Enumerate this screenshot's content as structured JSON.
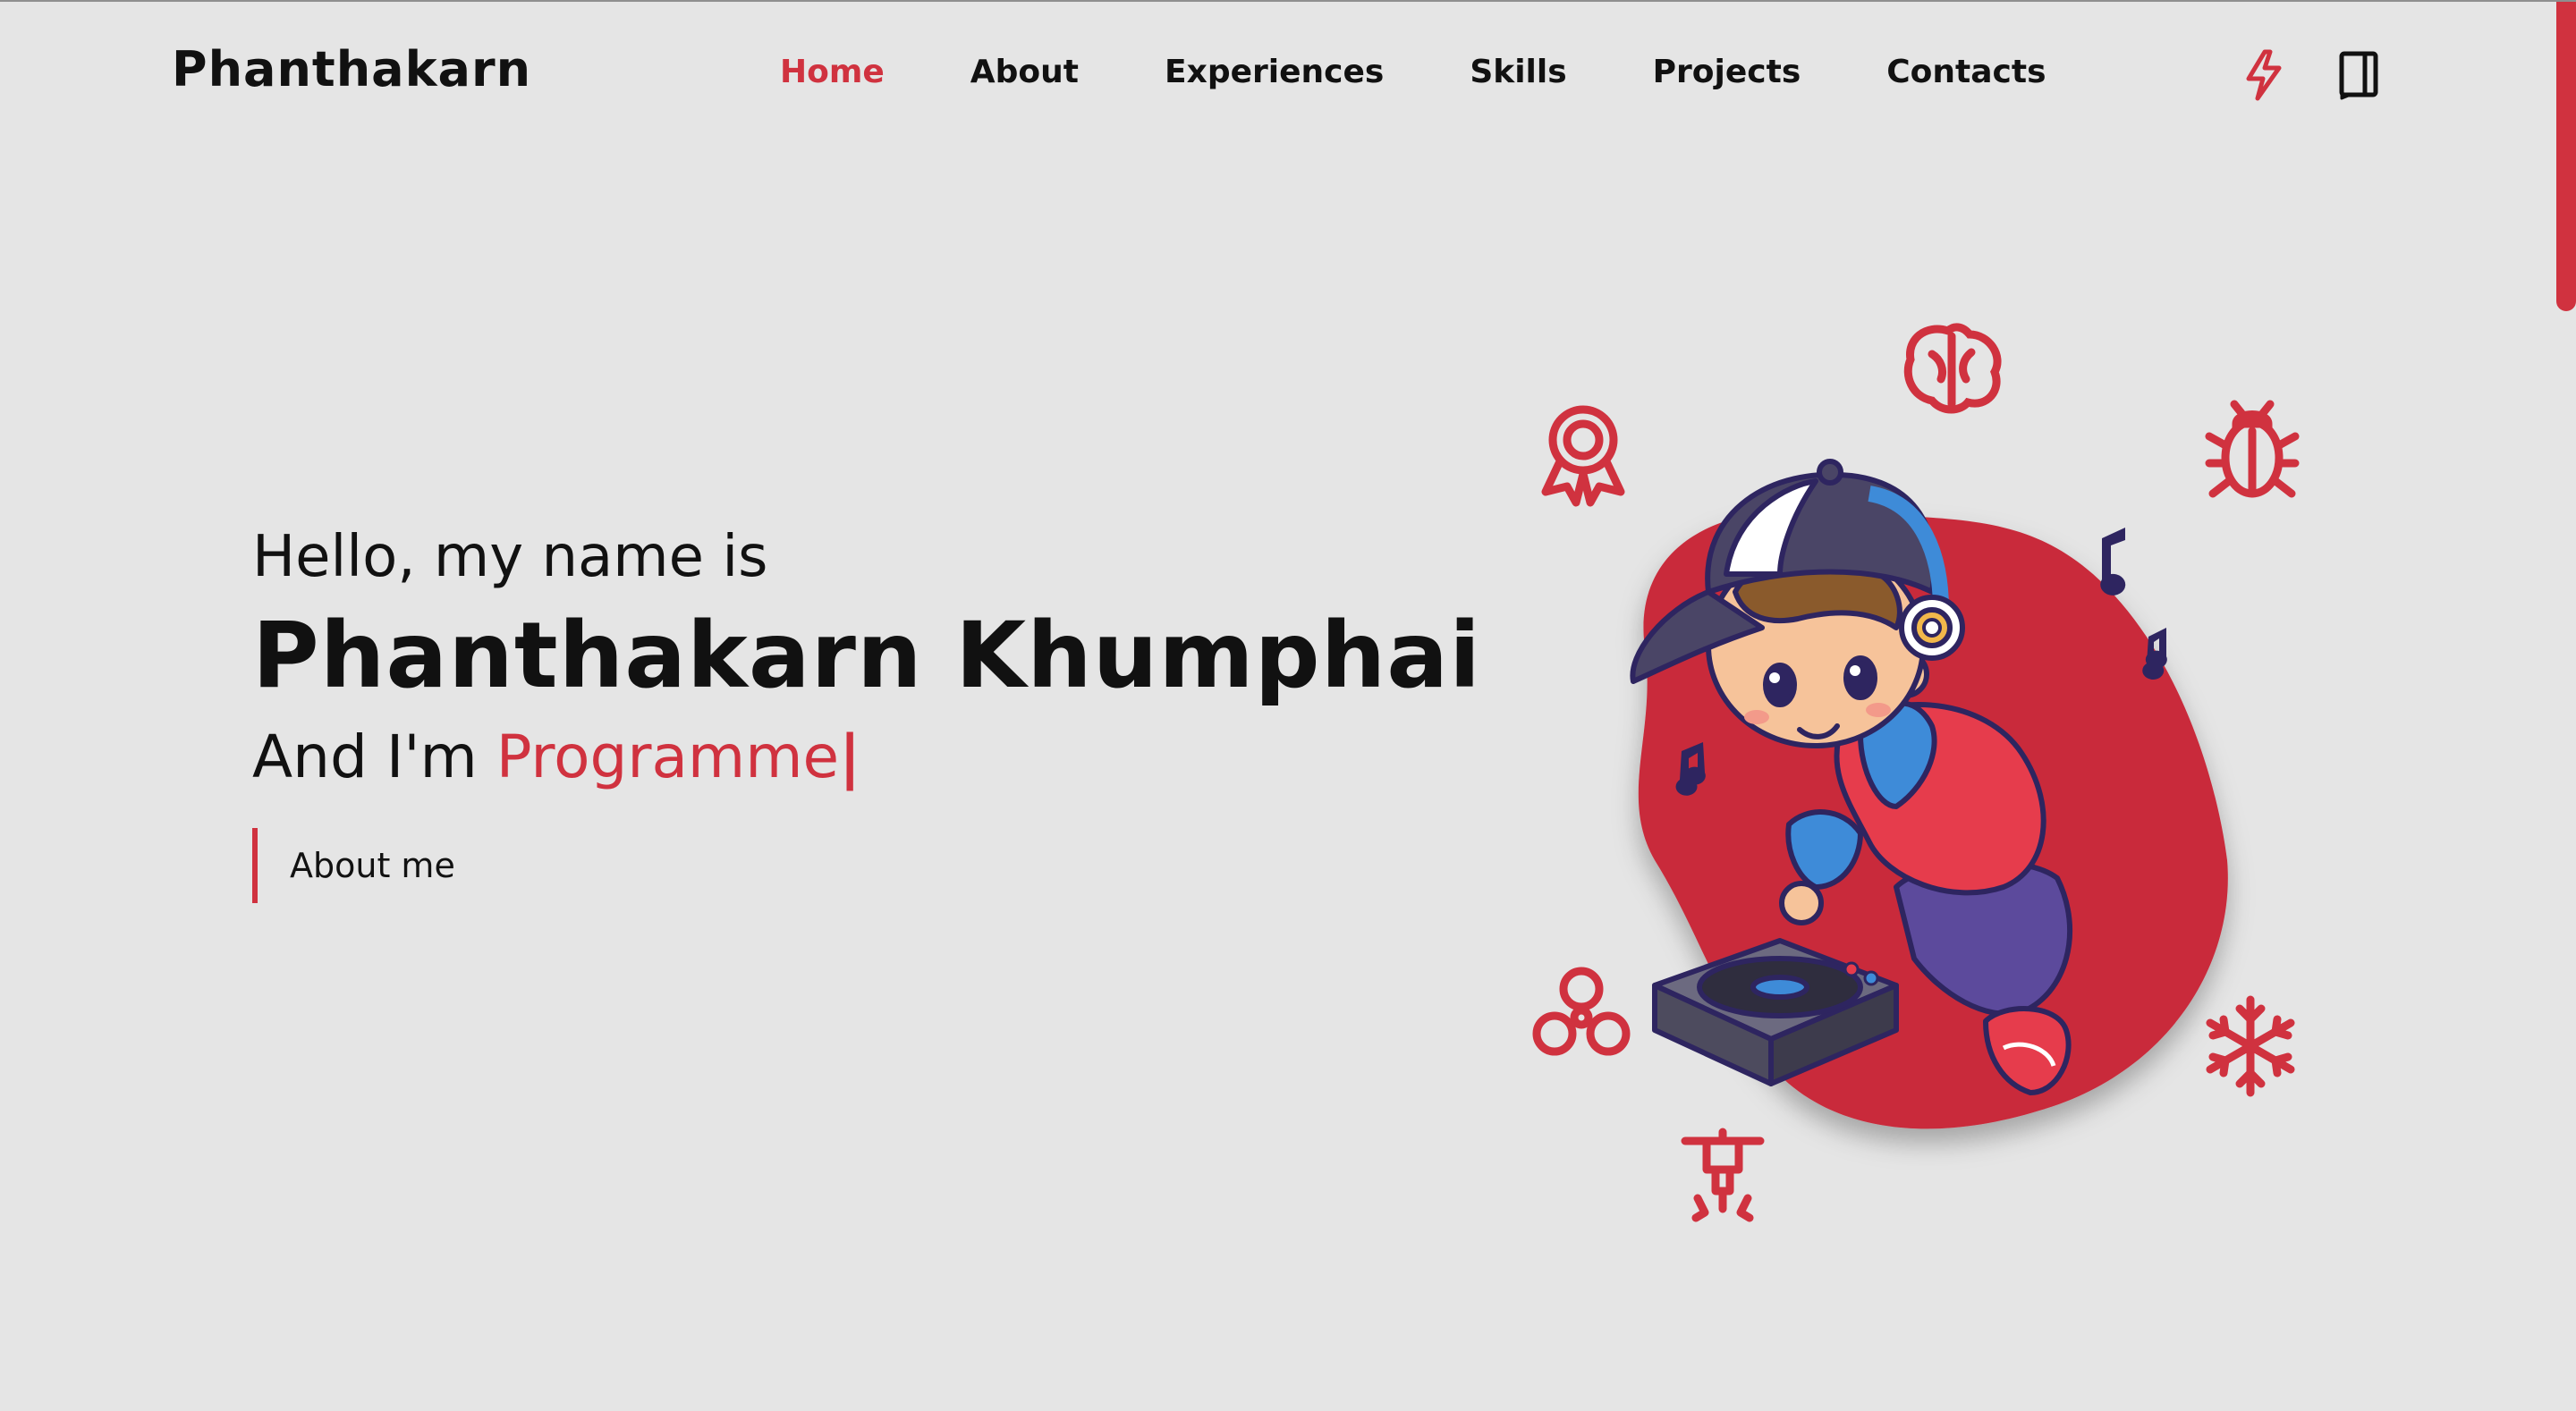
{
  "header": {
    "logo": "Phanthakarn",
    "nav": [
      {
        "label": "Home",
        "active": true
      },
      {
        "label": "About",
        "active": false
      },
      {
        "label": "Experiences",
        "active": false
      },
      {
        "label": "Skills",
        "active": false
      },
      {
        "label": "Projects",
        "active": false
      },
      {
        "label": "Contacts",
        "active": false
      }
    ],
    "icons": [
      "lightning-icon",
      "book-icon"
    ]
  },
  "hero": {
    "greeting": "Hello, my name is",
    "name": "Phanthakarn Khumphai",
    "role_prefix": "And I'm",
    "role_typed": "Programme",
    "caret": "|",
    "button": "About me"
  },
  "colors": {
    "accent": "#d0323f",
    "background": "#e5e5e5",
    "text": "#111111"
  },
  "illustration": {
    "subject": "cartoon-dj-boy",
    "floating_icons": [
      "brain-icon",
      "award-icon",
      "bug-icon",
      "music-note-icon",
      "fidget-spinner-icon",
      "jackhammer-icon",
      "snowflake-icon"
    ]
  }
}
